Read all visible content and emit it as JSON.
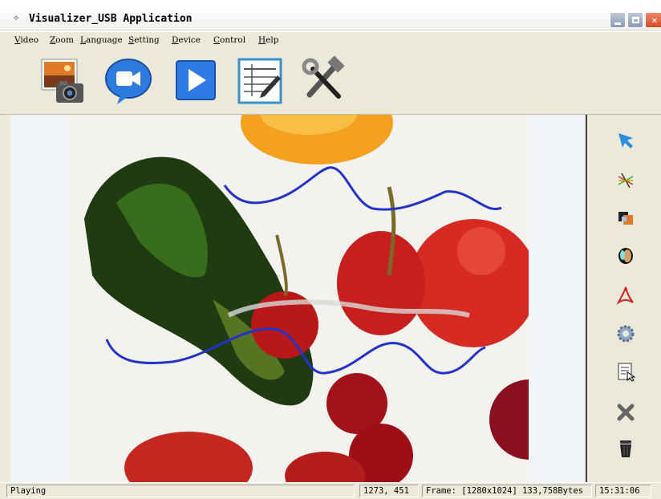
{
  "window": {
    "title": "Visualizer_USB Application"
  },
  "menu": [
    "Video",
    "Zoom",
    "Language",
    "Setting",
    "Device",
    "Control",
    "Help"
  ],
  "toolbar": {
    "buttons": [
      {
        "name": "capture-photo",
        "icon": "camera-photo-icon"
      },
      {
        "name": "record-video",
        "icon": "video-camera-icon"
      },
      {
        "name": "play",
        "icon": "play-icon"
      },
      {
        "name": "annotate-document",
        "icon": "document-pen-icon"
      },
      {
        "name": "tools",
        "icon": "hammer-wrench-icon"
      }
    ]
  },
  "side_tools": [
    {
      "name": "pointer",
      "icon": "arrow-pointer-icon"
    },
    {
      "name": "line-draw",
      "icon": "lines-icon"
    },
    {
      "name": "overlay",
      "icon": "overlay-squares-icon"
    },
    {
      "name": "spotlight",
      "icon": "spotlight-icon"
    },
    {
      "name": "pdf",
      "icon": "pdf-icon"
    },
    {
      "name": "settings",
      "icon": "gear-icon"
    },
    {
      "name": "capture-list",
      "icon": "list-cursor-icon"
    },
    {
      "name": "clear",
      "icon": "close-x-icon"
    },
    {
      "name": "trash",
      "icon": "trash-icon"
    }
  ],
  "status": {
    "state": "Playing",
    "coords": "1273, 451",
    "frame": "Frame: [1280x1024] 133,758Bytes",
    "time": "15:31:06"
  },
  "colors": {
    "accent": "#0A246A",
    "ink": "#2233CC",
    "close": "#D14A24"
  }
}
